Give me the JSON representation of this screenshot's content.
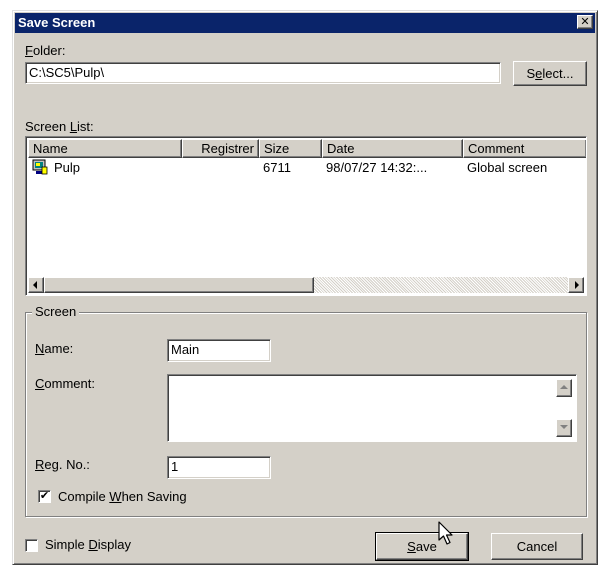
{
  "window": {
    "title": "Save Screen",
    "close_glyph": "✕"
  },
  "folder": {
    "label_mnemonic": "F",
    "label_rest": "older:",
    "value": "C:\\SC5\\Pulp\\",
    "select_pre": "S",
    "select_mnemonic": "e",
    "select_post": "lect..."
  },
  "screen_list": {
    "label_pre": "Screen ",
    "label_mnemonic": "L",
    "label_post": "ist:",
    "columns": [
      "Name",
      "Registrer",
      "Size",
      "Date",
      "Comment"
    ],
    "rows": [
      {
        "icon": "screen-file-icon",
        "name": "Pulp",
        "registrer": "",
        "size": "6711",
        "date": "98/07/27 14:32:...",
        "comment": "Global screen"
      }
    ]
  },
  "screen_group": {
    "legend": "Screen",
    "name_mnemonic": "N",
    "name_rest": "ame:",
    "name_value": "Main",
    "comment_mnemonic": "C",
    "comment_rest": "omment:",
    "comment_value": "",
    "regno_mnemonic": "R",
    "regno_rest": "eg. No.:",
    "regno_value": "1",
    "compile_pre": "Compile ",
    "compile_mnemonic": "W",
    "compile_post": "hen Saving",
    "compile_checked": true
  },
  "footer": {
    "simple_pre": "Simple ",
    "simple_mnemonic": "D",
    "simple_post": "isplay",
    "simple_checked": false,
    "save_mnemonic": "S",
    "save_rest": "ave",
    "cancel_label": "Cancel"
  },
  "colors": {
    "titlebar": "#0a246a",
    "face": "#d4d0c8",
    "shadow": "#808080",
    "window_bg": "#ffffff"
  }
}
